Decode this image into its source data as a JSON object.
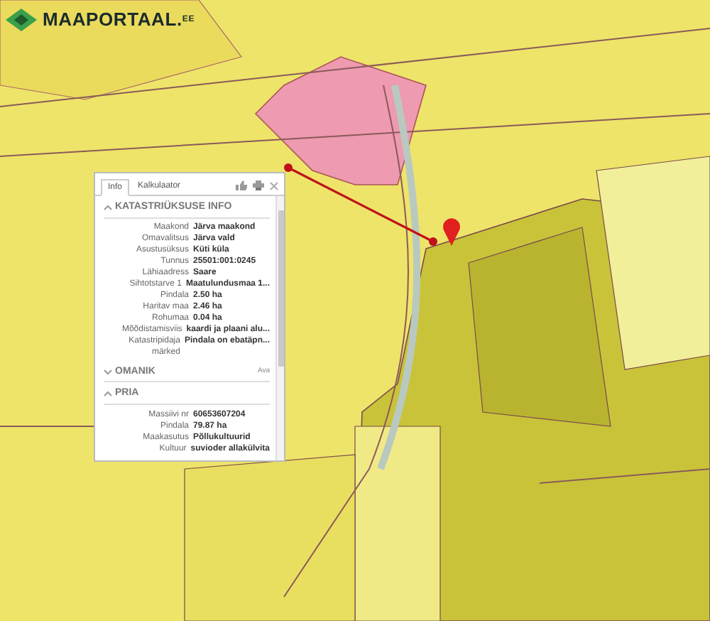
{
  "logo": {
    "text": "MAAPORTAAL.$^{EE}$"
  },
  "popup": {
    "tabs": [
      {
        "label": "Info",
        "selected": true
      },
      {
        "label": "Kalkulaator",
        "selected": false
      }
    ],
    "sections": [
      {
        "title": "KATASTRIÜKSUSE INFO",
        "expanded": true,
        "fields": [
          {
            "label": "Maakond",
            "value": "Järva maakond"
          },
          {
            "label": "Omavalitsus",
            "value": "Järva vald"
          },
          {
            "label": "Asustusüksus",
            "value": "Küti küla"
          },
          {
            "label": "Tunnus",
            "value": "25501:001:0245"
          },
          {
            "label": "Lähiaadress",
            "value": "Saare"
          },
          {
            "label": "Sihtotstarve 1",
            "value": "Maatulundusmaa 1..."
          },
          {
            "label": "Pindala",
            "value": "2.50 ha"
          },
          {
            "label": "Haritav maa",
            "value": "2.46 ha"
          },
          {
            "label": "Rohumaa",
            "value": "0.04 ha"
          },
          {
            "label": "Mõõdistamisviis",
            "value": "kaardi ja plaani alu..."
          },
          {
            "label": "Katastripidaja märked",
            "value": "Pindala on ebatäpn..."
          }
        ]
      },
      {
        "title": "OMANIK",
        "expanded": false,
        "action": "Ava"
      },
      {
        "title": "PRIA",
        "expanded": true,
        "fields": [
          {
            "label": "Massiivi nr",
            "value": "60653607204"
          },
          {
            "label": "Pindala",
            "value": "79.87 ha"
          },
          {
            "label": "Maakasutus",
            "value": "Põllukultuurid"
          },
          {
            "label": "Kultuur",
            "value": "suvioder allakülvita"
          }
        ]
      }
    ]
  }
}
